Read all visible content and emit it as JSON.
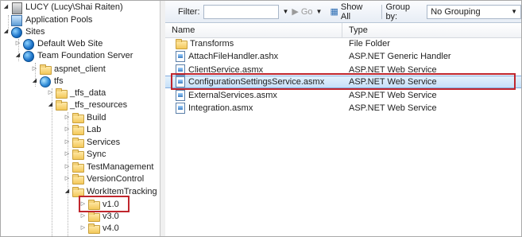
{
  "tree": {
    "root": "LUCY (Lucy\\Shai Raiten)",
    "application_pools": "Application Pools",
    "sites": "Sites",
    "default_web_site": "Default Web Site",
    "tfs_server": "Team Foundation Server",
    "aspnet_client": "aspnet_client",
    "tfs": "tfs",
    "tfs_data": "_tfs_data",
    "tfs_resources": "_tfs_resources",
    "build": "Build",
    "lab": "Lab",
    "services": "Services",
    "sync": "Sync",
    "test_management": "TestManagement",
    "version_control": "VersionControl",
    "work_item_tracking": "WorkItemTracking",
    "v10": "v1.0",
    "v30": "v3.0",
    "v40": "v4.0"
  },
  "toolbar": {
    "filter_label": "Filter:",
    "go_label": "Go",
    "show_all_label": "Show All",
    "group_by_label": "Group by:",
    "group_by_value": "No Grouping"
  },
  "columns": {
    "name": "Name",
    "type": "Type"
  },
  "files": [
    {
      "name": "Transforms",
      "type": "File Folder",
      "icon": "folder-icon"
    },
    {
      "name": "AttachFileHandler.ashx",
      "type": "ASP.NET Generic Handler",
      "icon": "file-icon"
    },
    {
      "name": "ClientService.asmx",
      "type": "ASP.NET Web Service",
      "icon": "file-icon"
    },
    {
      "name": "ConfigurationSettingsService.asmx",
      "type": "ASP.NET Web Service",
      "icon": "file-icon"
    },
    {
      "name": "ExternalServices.asmx",
      "type": "ASP.NET Web Service",
      "icon": "file-icon"
    },
    {
      "name": "Integration.asmx",
      "type": "ASP.NET Web Service",
      "icon": "file-icon"
    }
  ],
  "colors": {
    "highlight": "#c0262d",
    "selection": "#c6e0f8"
  }
}
